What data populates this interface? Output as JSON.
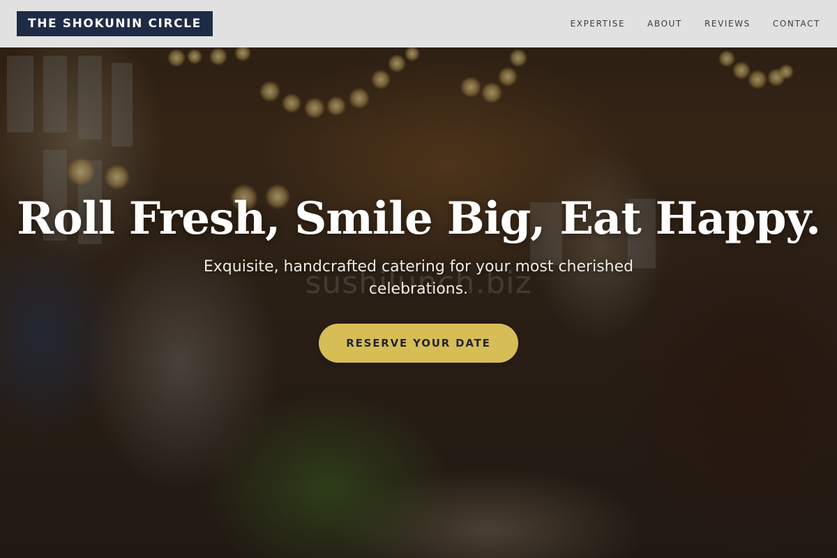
{
  "header": {
    "brand": "THE SHOKUNIN CIRCLE",
    "nav": [
      {
        "label": "EXPERTISE"
      },
      {
        "label": "ABOUT"
      },
      {
        "label": "REVIEWS"
      },
      {
        "label": "CONTACT"
      }
    ]
  },
  "hero": {
    "title": "Roll Fresh, Smile Big, Eat Happy.",
    "subtitle": "Exquisite, handcrafted catering for your most cherished celebrations.",
    "watermark": "sushilunch.biz",
    "cta_label": "RESERVE YOUR DATE"
  },
  "colors": {
    "brand_bg": "#1f2b45",
    "header_bg": "#eeeeee",
    "cta_bg": "#d6bd56",
    "cta_text": "#23252d",
    "title_text": "#ffffff"
  }
}
